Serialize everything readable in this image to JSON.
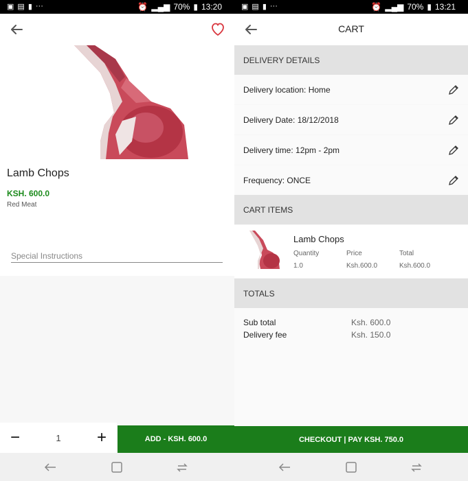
{
  "left_screen": {
    "status_bar": {
      "time": "13:20",
      "battery": "70%"
    },
    "product": {
      "name": "Lamb Chops",
      "price": "KSH. 600.0",
      "category": "Red Meat"
    },
    "special_instructions": {
      "placeholder": "Special Instructions",
      "value": ""
    },
    "quantity": {
      "minus": "−",
      "value": "1",
      "plus": "+"
    },
    "add_button": "ADD - KSH. 600.0"
  },
  "right_screen": {
    "status_bar": {
      "time": "13:21",
      "battery": "70%"
    },
    "title": "CART",
    "delivery_details": {
      "heading": "DELIVERY DETAILS",
      "rows": [
        "Delivery location: Home",
        "Delivery Date: 18/12/2018",
        "Delivery time: 12pm - 2pm",
        "Frequency: ONCE"
      ]
    },
    "cart_items": {
      "heading": "CART ITEMS",
      "items": [
        {
          "name": "Lamb Chops",
          "quantity_label": "Quantity",
          "price_label": "Price",
          "total_label": "Total",
          "quantity": "1.0",
          "price": "Ksh.600.0",
          "total": "Ksh.600.0"
        }
      ]
    },
    "totals": {
      "heading": "TOTALS",
      "sub_total_label": "Sub total",
      "sub_total": "Ksh. 600.0",
      "delivery_fee_label": "Delivery fee",
      "delivery_fee": "Ksh. 150.0"
    },
    "checkout_button": "CHECKOUT | PAY KSH. 750.0"
  },
  "colors": {
    "accent_green": "#1b7d1b",
    "price_green": "#1b8a1b",
    "heart_red": "#d9363e"
  },
  "icons": [
    "back-arrow-icon",
    "heart-icon",
    "edit-pencil-icon",
    "nav-back-icon",
    "nav-home-icon",
    "nav-recents-icon"
  ]
}
